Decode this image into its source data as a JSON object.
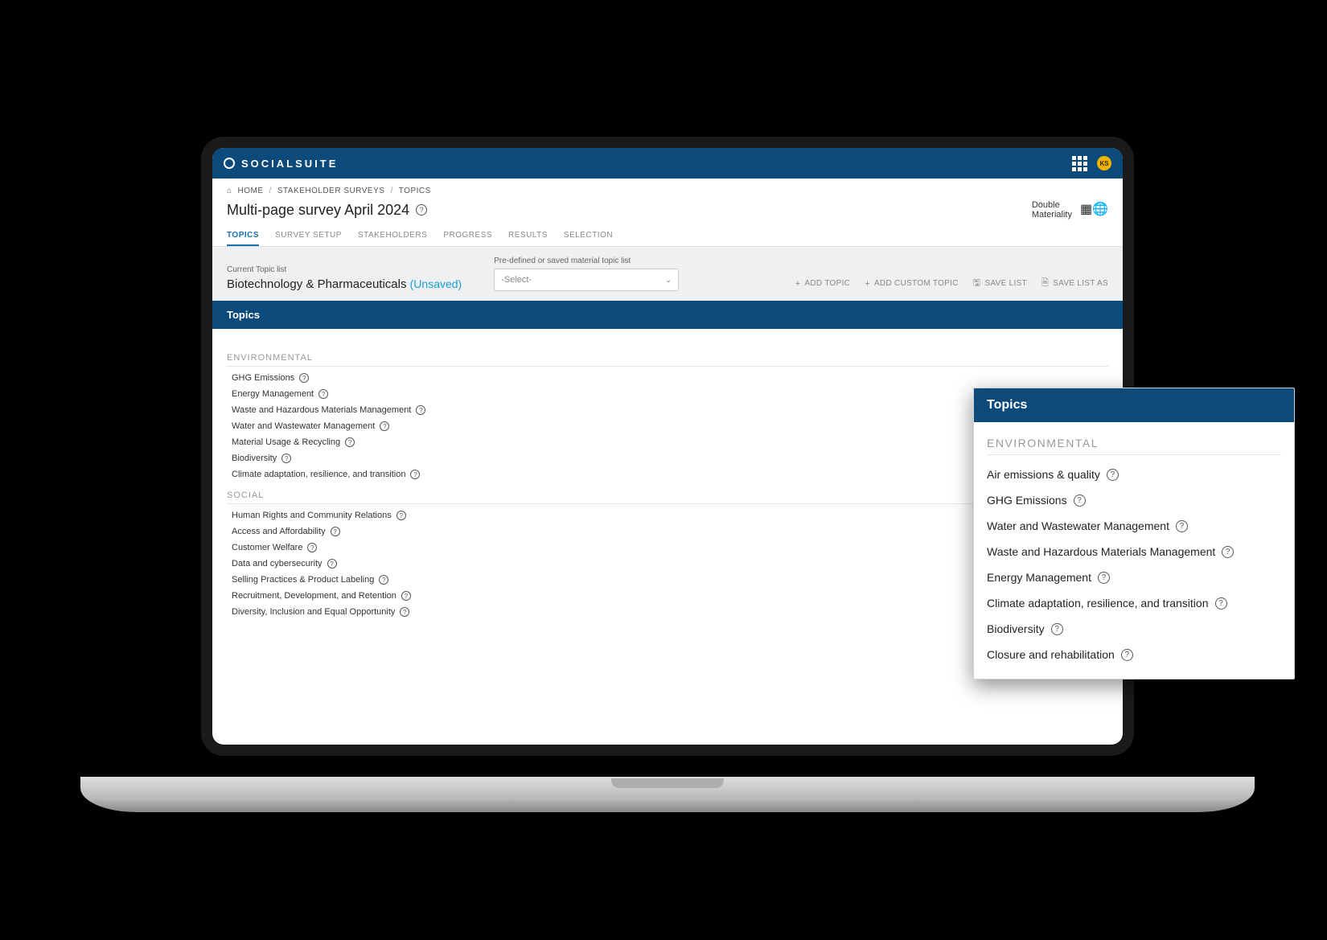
{
  "brand": "SOCIALSUITE",
  "avatar": "KS",
  "breadcrumb": {
    "home": "HOME",
    "l1": "STAKEHOLDER SURVEYS",
    "l2": "TOPICS"
  },
  "page_title": "Multi-page survey April 2024",
  "dm_label1": "Double",
  "dm_label2": "Materiality",
  "tabs": [
    {
      "label": "TOPICS",
      "active": true
    },
    {
      "label": "SURVEY SETUP"
    },
    {
      "label": "STAKEHOLDERS"
    },
    {
      "label": "PROGRESS"
    },
    {
      "label": "RESULTS"
    },
    {
      "label": "SELECTION"
    }
  ],
  "toolbar": {
    "current_label": "Current Topic list",
    "current_value": "Biotechnology & Pharmaceuticals",
    "unsaved": "(Unsaved)",
    "predef_label": "Pre-defined or saved material topic list",
    "select_value": "-Select-",
    "add_topic": "ADD TOPIC",
    "add_custom": "ADD CUSTOM TOPIC",
    "save_list": "SAVE LIST",
    "save_list_as": "SAVE LIST AS"
  },
  "section_title": "Topics",
  "groups": [
    {
      "name": "ENVIRONMENTAL",
      "items": [
        "GHG Emissions",
        "Energy Management",
        "Waste and Hazardous Materials Management",
        "Water and Wastewater Management",
        "Material Usage & Recycling",
        "Biodiversity",
        "Climate adaptation, resilience, and transition"
      ]
    },
    {
      "name": "SOCIAL",
      "items": [
        "Human Rights and Community Relations",
        "Access and Affordability",
        "Customer Welfare",
        "Data and cybersecurity",
        "Selling Practices & Product Labeling",
        "Recruitment, Development, and Retention",
        "Diversity, Inclusion and Equal Opportunity"
      ]
    }
  ],
  "panel": {
    "title": "Topics",
    "group": "ENVIRONMENTAL",
    "items": [
      "Air emissions & quality",
      "GHG Emissions",
      "Water and Wastewater Management",
      "Waste and Hazardous Materials Management",
      "Energy Management",
      "Climate adaptation, resilience, and transition",
      "Biodiversity",
      "Closure and rehabilitation"
    ]
  }
}
